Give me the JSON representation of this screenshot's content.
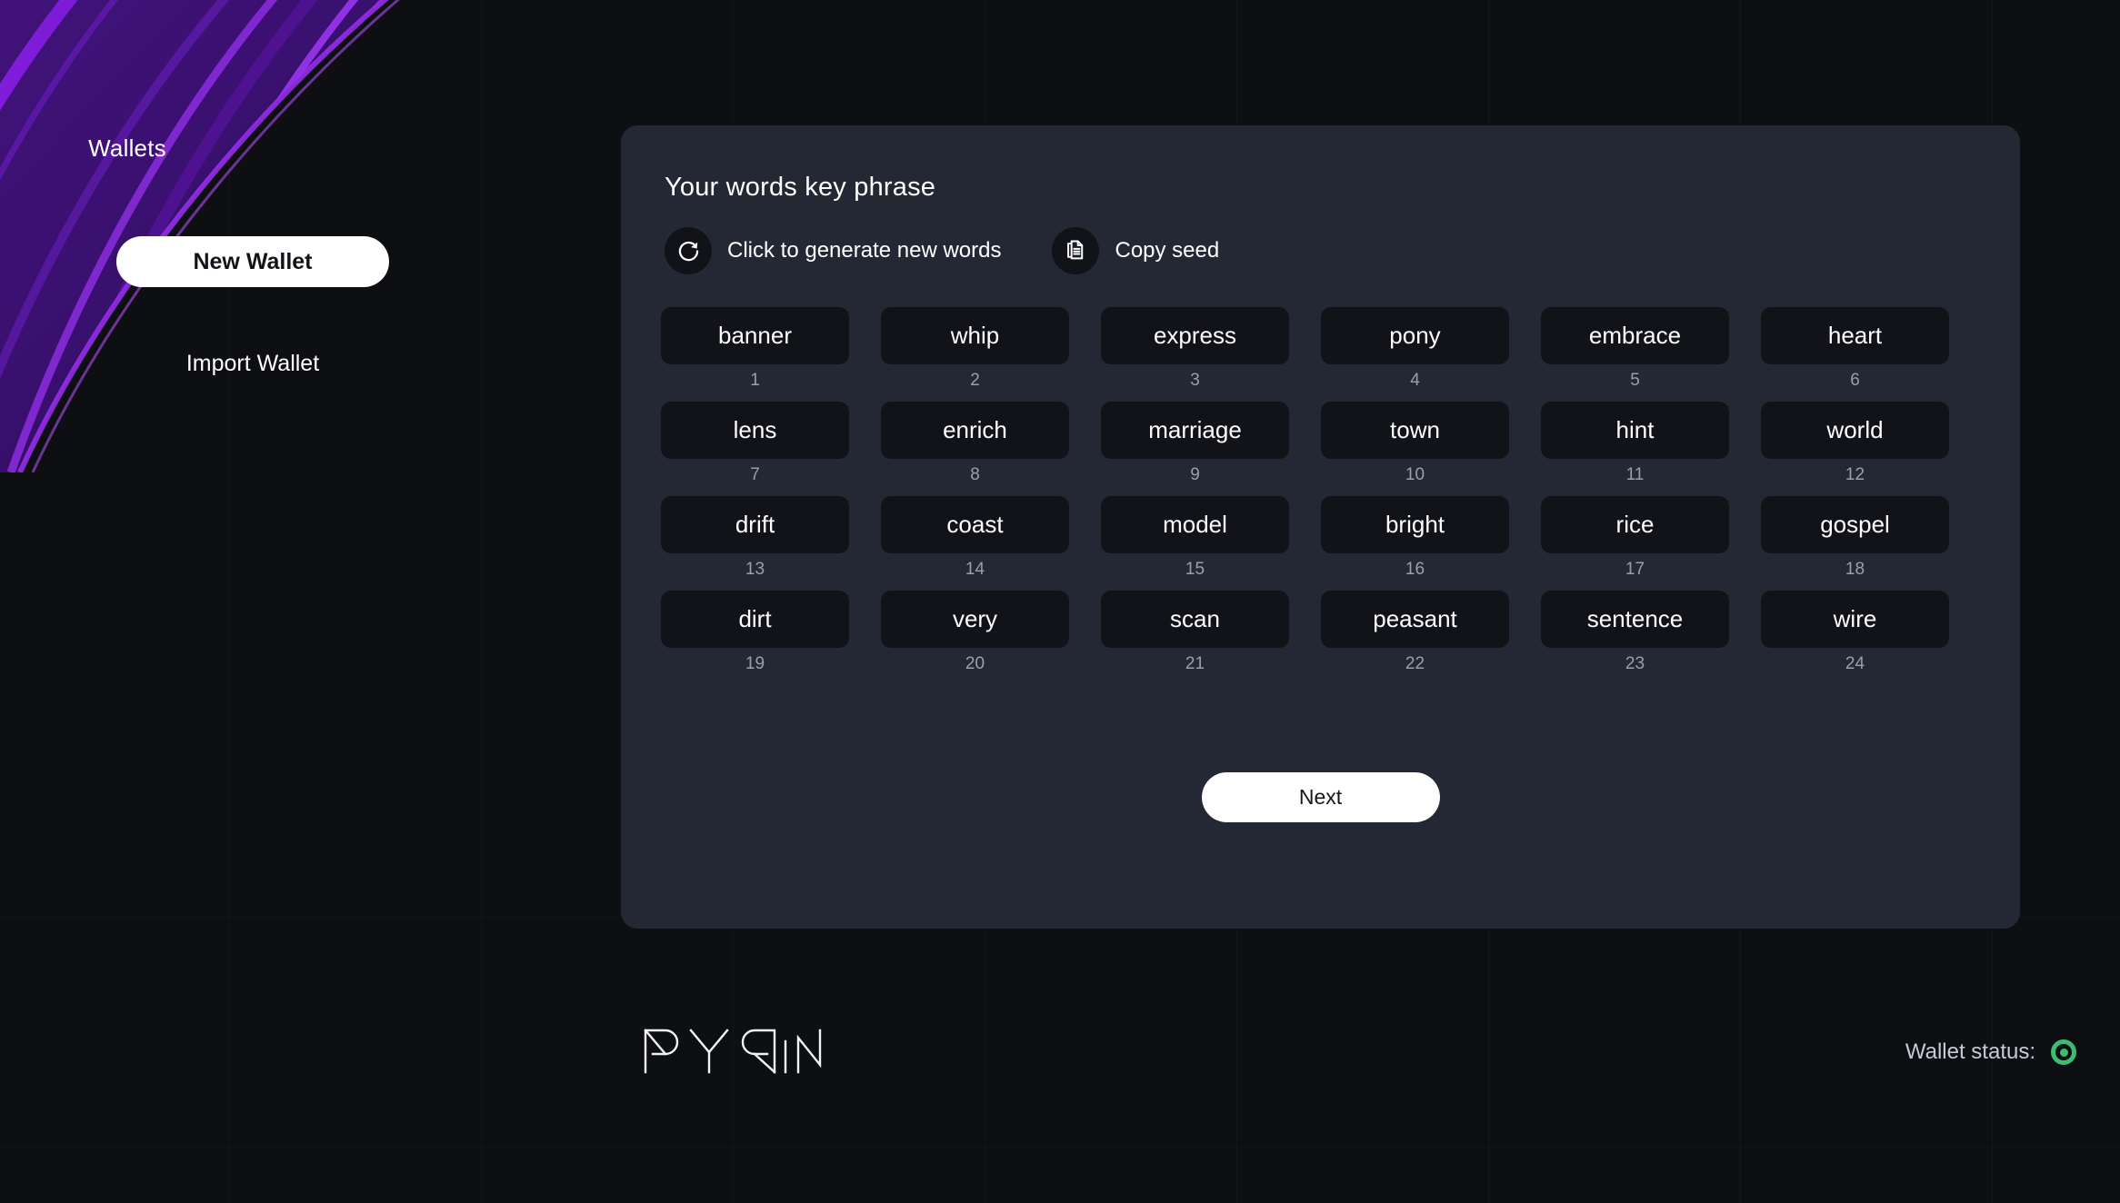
{
  "sidebar": {
    "title": "Wallets",
    "new_wallet_label": "New Wallet",
    "import_wallet_label": "Import Wallet"
  },
  "panel": {
    "title": "Your words key phrase",
    "actions": [
      {
        "icon": "refresh-icon",
        "label": "Click to generate new words"
      },
      {
        "icon": "copy-document-icon",
        "label": "Copy seed"
      }
    ],
    "next_label": "Next",
    "words": [
      {
        "index": "1",
        "word": "banner"
      },
      {
        "index": "2",
        "word": "whip"
      },
      {
        "index": "3",
        "word": "express"
      },
      {
        "index": "4",
        "word": "pony"
      },
      {
        "index": "5",
        "word": "embrace"
      },
      {
        "index": "6",
        "word": "heart"
      },
      {
        "index": "7",
        "word": "lens"
      },
      {
        "index": "8",
        "word": "enrich"
      },
      {
        "index": "9",
        "word": "marriage"
      },
      {
        "index": "10",
        "word": "town"
      },
      {
        "index": "11",
        "word": "hint"
      },
      {
        "index": "12",
        "word": "world"
      },
      {
        "index": "13",
        "word": "drift"
      },
      {
        "index": "14",
        "word": "coast"
      },
      {
        "index": "15",
        "word": "model"
      },
      {
        "index": "16",
        "word": "bright"
      },
      {
        "index": "17",
        "word": "rice"
      },
      {
        "index": "18",
        "word": "gospel"
      },
      {
        "index": "19",
        "word": "dirt"
      },
      {
        "index": "20",
        "word": "very"
      },
      {
        "index": "21",
        "word": "scan"
      },
      {
        "index": "22",
        "word": "peasant"
      },
      {
        "index": "23",
        "word": "sentence"
      },
      {
        "index": "24",
        "word": "wire"
      }
    ]
  },
  "footer": {
    "logo_text": "PYRIN",
    "status_label": "Wallet status:",
    "status_color": "#3dbb74"
  },
  "theme": {
    "background": "#0e0f13",
    "panel": "#242834",
    "chip": "#121318",
    "accent_purple": "#7d21d6",
    "accent_purple_bright": "#a53bff",
    "text_primary": "#ffffff",
    "text_muted": "#9aa0ab"
  }
}
